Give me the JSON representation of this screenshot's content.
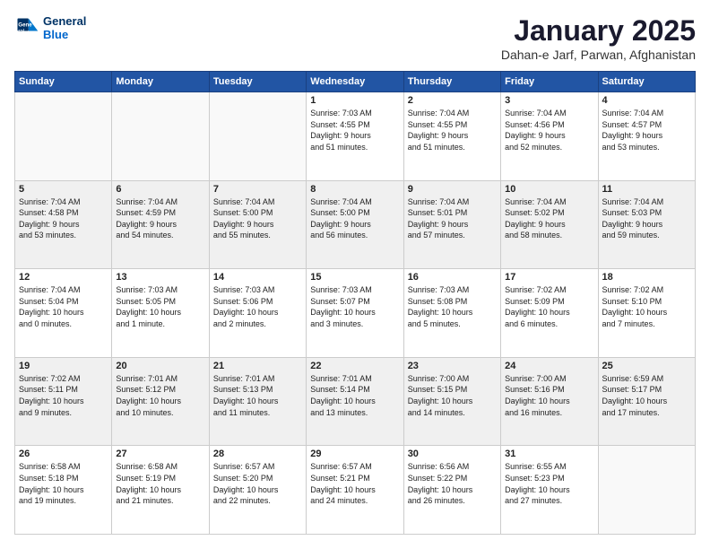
{
  "logo": {
    "line1": "General",
    "line2": "Blue"
  },
  "title": "January 2025",
  "subtitle": "Dahan-e Jarf, Parwan, Afghanistan",
  "days_header": [
    "Sunday",
    "Monday",
    "Tuesday",
    "Wednesday",
    "Thursday",
    "Friday",
    "Saturday"
  ],
  "weeks": [
    {
      "shaded": false,
      "days": [
        {
          "num": "",
          "info": ""
        },
        {
          "num": "",
          "info": ""
        },
        {
          "num": "",
          "info": ""
        },
        {
          "num": "1",
          "info": "Sunrise: 7:03 AM\nSunset: 4:55 PM\nDaylight: 9 hours\nand 51 minutes."
        },
        {
          "num": "2",
          "info": "Sunrise: 7:04 AM\nSunset: 4:55 PM\nDaylight: 9 hours\nand 51 minutes."
        },
        {
          "num": "3",
          "info": "Sunrise: 7:04 AM\nSunset: 4:56 PM\nDaylight: 9 hours\nand 52 minutes."
        },
        {
          "num": "4",
          "info": "Sunrise: 7:04 AM\nSunset: 4:57 PM\nDaylight: 9 hours\nand 53 minutes."
        }
      ]
    },
    {
      "shaded": true,
      "days": [
        {
          "num": "5",
          "info": "Sunrise: 7:04 AM\nSunset: 4:58 PM\nDaylight: 9 hours\nand 53 minutes."
        },
        {
          "num": "6",
          "info": "Sunrise: 7:04 AM\nSunset: 4:59 PM\nDaylight: 9 hours\nand 54 minutes."
        },
        {
          "num": "7",
          "info": "Sunrise: 7:04 AM\nSunset: 5:00 PM\nDaylight: 9 hours\nand 55 minutes."
        },
        {
          "num": "8",
          "info": "Sunrise: 7:04 AM\nSunset: 5:00 PM\nDaylight: 9 hours\nand 56 minutes."
        },
        {
          "num": "9",
          "info": "Sunrise: 7:04 AM\nSunset: 5:01 PM\nDaylight: 9 hours\nand 57 minutes."
        },
        {
          "num": "10",
          "info": "Sunrise: 7:04 AM\nSunset: 5:02 PM\nDaylight: 9 hours\nand 58 minutes."
        },
        {
          "num": "11",
          "info": "Sunrise: 7:04 AM\nSunset: 5:03 PM\nDaylight: 9 hours\nand 59 minutes."
        }
      ]
    },
    {
      "shaded": false,
      "days": [
        {
          "num": "12",
          "info": "Sunrise: 7:04 AM\nSunset: 5:04 PM\nDaylight: 10 hours\nand 0 minutes."
        },
        {
          "num": "13",
          "info": "Sunrise: 7:03 AM\nSunset: 5:05 PM\nDaylight: 10 hours\nand 1 minute."
        },
        {
          "num": "14",
          "info": "Sunrise: 7:03 AM\nSunset: 5:06 PM\nDaylight: 10 hours\nand 2 minutes."
        },
        {
          "num": "15",
          "info": "Sunrise: 7:03 AM\nSunset: 5:07 PM\nDaylight: 10 hours\nand 3 minutes."
        },
        {
          "num": "16",
          "info": "Sunrise: 7:03 AM\nSunset: 5:08 PM\nDaylight: 10 hours\nand 5 minutes."
        },
        {
          "num": "17",
          "info": "Sunrise: 7:02 AM\nSunset: 5:09 PM\nDaylight: 10 hours\nand 6 minutes."
        },
        {
          "num": "18",
          "info": "Sunrise: 7:02 AM\nSunset: 5:10 PM\nDaylight: 10 hours\nand 7 minutes."
        }
      ]
    },
    {
      "shaded": true,
      "days": [
        {
          "num": "19",
          "info": "Sunrise: 7:02 AM\nSunset: 5:11 PM\nDaylight: 10 hours\nand 9 minutes."
        },
        {
          "num": "20",
          "info": "Sunrise: 7:01 AM\nSunset: 5:12 PM\nDaylight: 10 hours\nand 10 minutes."
        },
        {
          "num": "21",
          "info": "Sunrise: 7:01 AM\nSunset: 5:13 PM\nDaylight: 10 hours\nand 11 minutes."
        },
        {
          "num": "22",
          "info": "Sunrise: 7:01 AM\nSunset: 5:14 PM\nDaylight: 10 hours\nand 13 minutes."
        },
        {
          "num": "23",
          "info": "Sunrise: 7:00 AM\nSunset: 5:15 PM\nDaylight: 10 hours\nand 14 minutes."
        },
        {
          "num": "24",
          "info": "Sunrise: 7:00 AM\nSunset: 5:16 PM\nDaylight: 10 hours\nand 16 minutes."
        },
        {
          "num": "25",
          "info": "Sunrise: 6:59 AM\nSunset: 5:17 PM\nDaylight: 10 hours\nand 17 minutes."
        }
      ]
    },
    {
      "shaded": false,
      "days": [
        {
          "num": "26",
          "info": "Sunrise: 6:58 AM\nSunset: 5:18 PM\nDaylight: 10 hours\nand 19 minutes."
        },
        {
          "num": "27",
          "info": "Sunrise: 6:58 AM\nSunset: 5:19 PM\nDaylight: 10 hours\nand 21 minutes."
        },
        {
          "num": "28",
          "info": "Sunrise: 6:57 AM\nSunset: 5:20 PM\nDaylight: 10 hours\nand 22 minutes."
        },
        {
          "num": "29",
          "info": "Sunrise: 6:57 AM\nSunset: 5:21 PM\nDaylight: 10 hours\nand 24 minutes."
        },
        {
          "num": "30",
          "info": "Sunrise: 6:56 AM\nSunset: 5:22 PM\nDaylight: 10 hours\nand 26 minutes."
        },
        {
          "num": "31",
          "info": "Sunrise: 6:55 AM\nSunset: 5:23 PM\nDaylight: 10 hours\nand 27 minutes."
        },
        {
          "num": "",
          "info": ""
        }
      ]
    }
  ]
}
